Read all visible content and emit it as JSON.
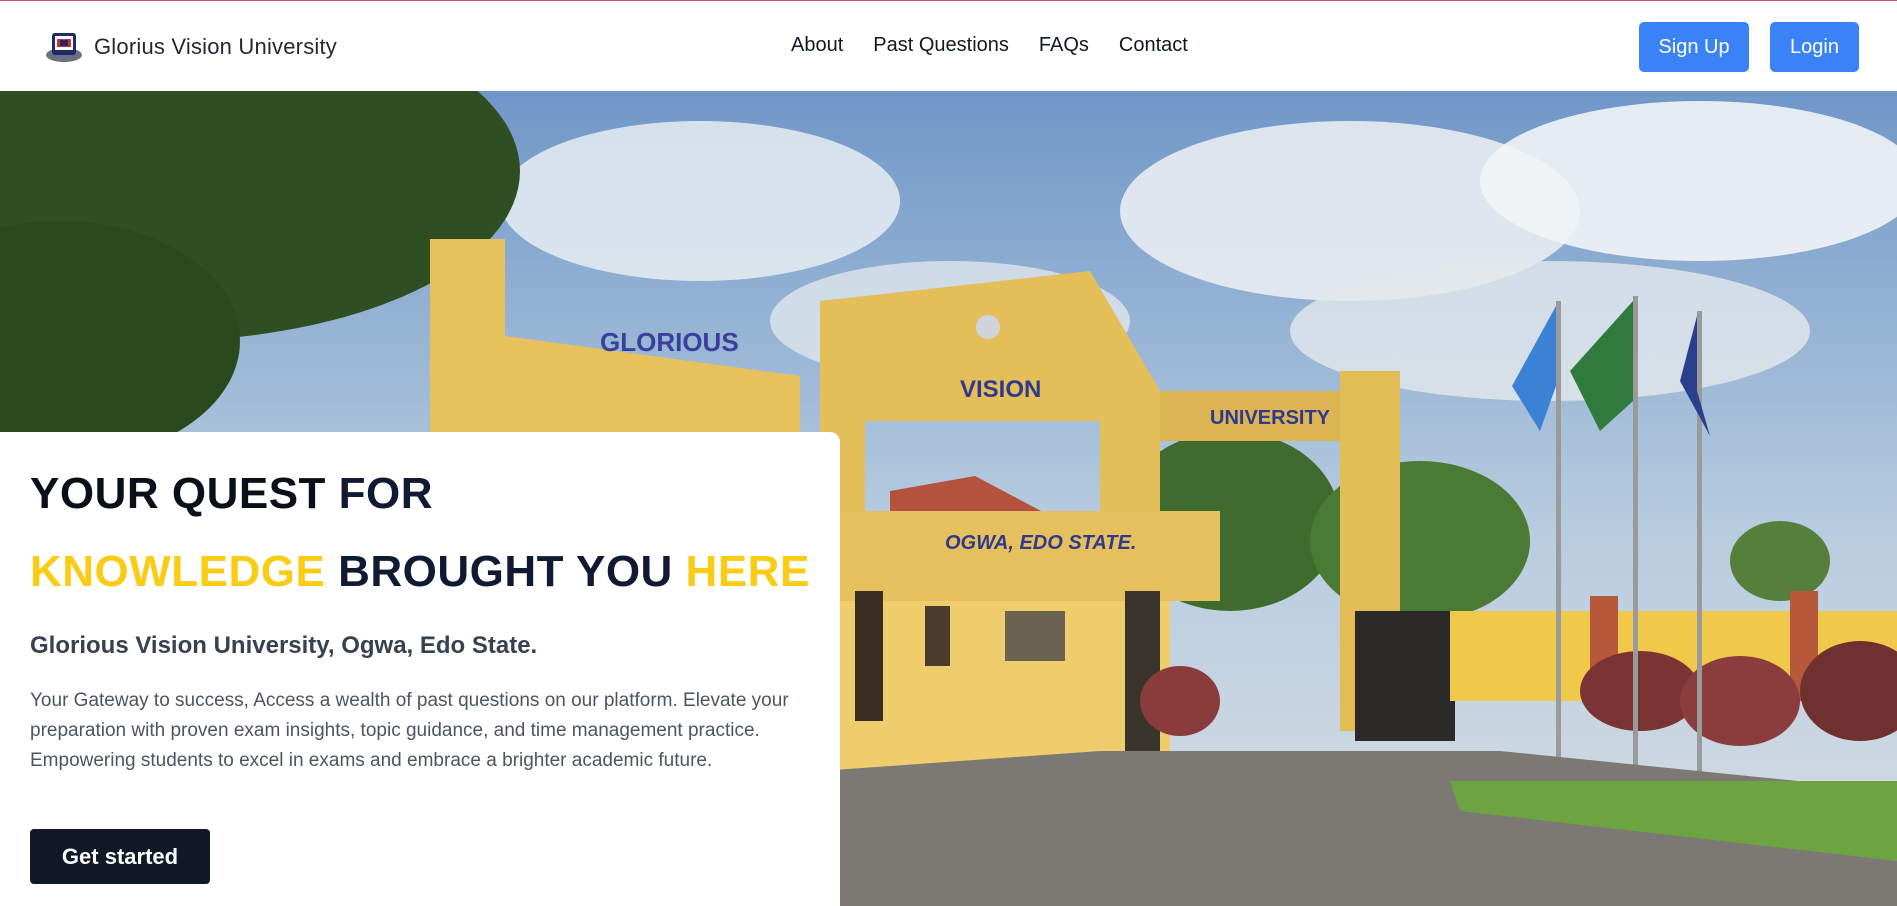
{
  "navbar": {
    "brand_name": "Glorius Vision University",
    "links": [
      "About",
      "Past Questions",
      "FAQs",
      "Contact"
    ],
    "signup_label": "Sign Up",
    "login_label": "Login"
  },
  "hero": {
    "headline": {
      "part1": "YOUR QUEST ",
      "part2": "FOR",
      "part3": "KNOWLEDGE",
      "part4": " BROUGHT YOU ",
      "part5": "HERE"
    },
    "subtitle": "Glorious Vision University, Ogwa, Edo State.",
    "description": "Your Gateway to success, Access a wealth of past questions on our platform. Elevate your preparation with proven exam insights, topic guidance, and time management practice. Empowering students to excel in exams and embrace a brighter academic future.",
    "cta_label": "Get started",
    "photo_signs": {
      "gate_left": "GLORIOUS",
      "gate_middle": "VISION",
      "gate_right": "UNIVERSITY",
      "gatehouse": "OGWA, EDO STATE."
    }
  },
  "colors": {
    "accent_blue": "#3b82f6",
    "accent_yellow": "#facc15",
    "dark_navy": "#111827"
  }
}
